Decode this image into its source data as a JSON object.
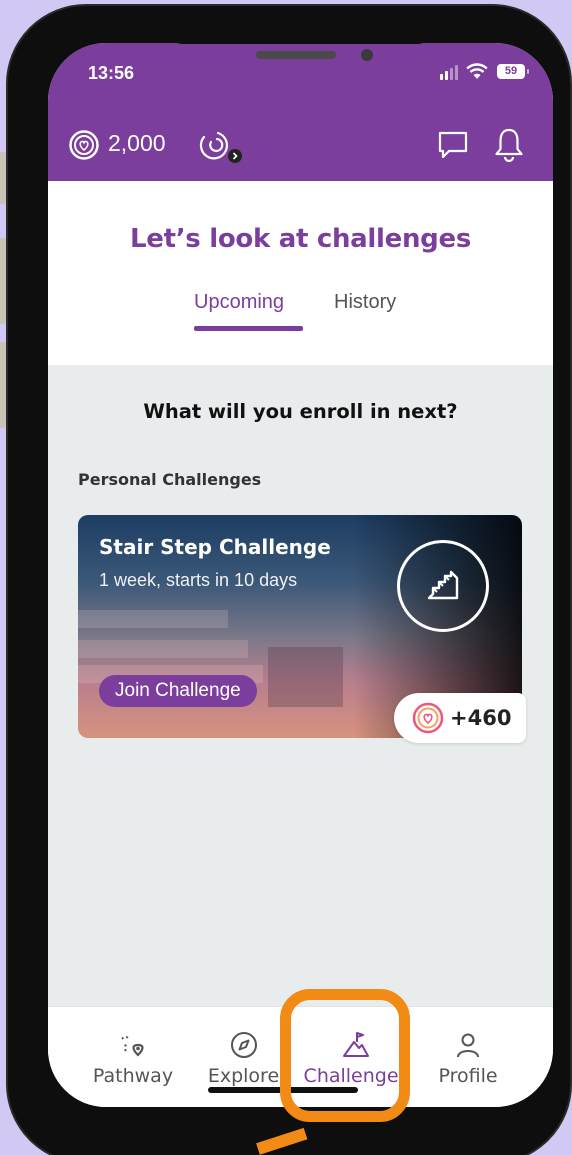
{
  "status_bar": {
    "time": "13:56",
    "battery": "59"
  },
  "app_bar": {
    "coins": "2,000",
    "icons": [
      "coin-heart-icon",
      "activity-ring-icon",
      "chat-icon",
      "bell-icon"
    ]
  },
  "header": {
    "title": "Let’s look at challenges",
    "tabs": [
      {
        "label": "Upcoming",
        "active": true
      },
      {
        "label": "History",
        "active": false
      }
    ]
  },
  "main": {
    "prompt": "What will you enroll in next?",
    "section_label": "Personal Challenges",
    "card": {
      "title": "Stair Step Challenge",
      "subtitle": "1 week, starts in 10 days",
      "icon": "stairs-icon",
      "button": "Join Challenge",
      "points": "+460"
    }
  },
  "nav": [
    {
      "label": "Pathway",
      "icon": "pathway-icon",
      "active": false
    },
    {
      "label": "Explore",
      "icon": "compass-icon",
      "active": false
    },
    {
      "label": "Challenges",
      "icon": "mountain-flag-icon",
      "active": true
    },
    {
      "label": "Profile",
      "icon": "person-icon",
      "active": false
    }
  ],
  "colors": {
    "brand_purple": "#7c3e9c",
    "highlight_orange": "#f28a16",
    "background": "#d2c8f4"
  }
}
